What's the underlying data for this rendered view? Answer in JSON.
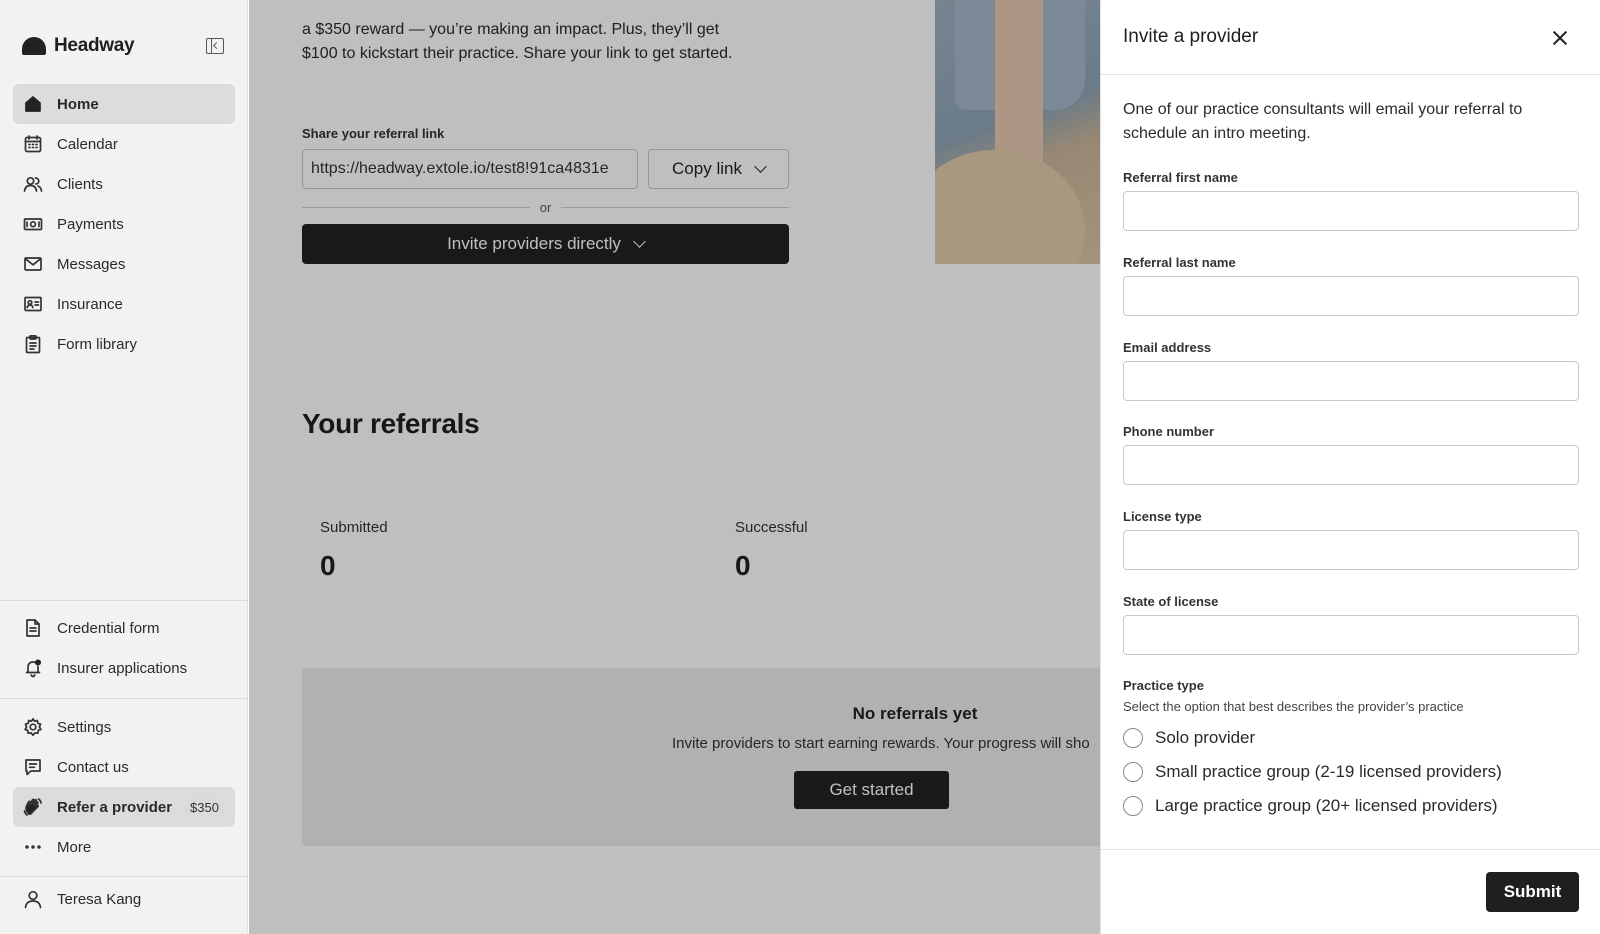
{
  "brand": {
    "name": "Headway",
    "logo_icon": "headway-logo-icon"
  },
  "sidebar": {
    "main_items": [
      {
        "label": "Home",
        "icon": "home-icon",
        "active": true
      },
      {
        "label": "Calendar",
        "icon": "calendar-icon"
      },
      {
        "label": "Clients",
        "icon": "clients-icon"
      },
      {
        "label": "Payments",
        "icon": "payments-icon"
      },
      {
        "label": "Messages",
        "icon": "envelope-icon"
      },
      {
        "label": "Insurance",
        "icon": "id-card-icon"
      },
      {
        "label": "Form library",
        "icon": "clipboard-icon"
      }
    ],
    "mid_items": [
      {
        "label": "Credential form",
        "icon": "document-icon"
      },
      {
        "label": "Insurer applications",
        "icon": "bell-icon"
      }
    ],
    "bottom_items": [
      {
        "label": "Settings",
        "icon": "gear-icon"
      },
      {
        "label": "Contact us",
        "icon": "chat-icon"
      },
      {
        "label": "Refer a provider",
        "icon": "waving-hand-icon",
        "badge": "$350",
        "active": true
      },
      {
        "label": "More",
        "icon": "more-dots-icon"
      }
    ],
    "user": {
      "name": "Teresa Kang",
      "icon": "user-icon"
    }
  },
  "main": {
    "intro_line1": "a $350 reward — you’re making an impact. Plus, they’ll get",
    "intro_line2": "$100 to kickstart their practice. Share your link to get started.",
    "share_label": "Share your referral link",
    "referral_link": "https://headway.extole.io/test8!91ca4831e",
    "copy_link_label": "Copy link",
    "or_text": "or",
    "invite_directly_label": "Invite providers directly",
    "referrals_title": "Your referrals",
    "stats": {
      "submitted_label": "Submitted",
      "submitted_value": "0",
      "successful_label": "Successful",
      "successful_value": "0"
    },
    "empty_state": {
      "title": "No referrals yet",
      "subtitle": "Invite providers to start earning rewards. Your progress will sho",
      "button_label": "Get started"
    }
  },
  "drawer": {
    "title": "Invite a provider",
    "description": "One of our practice consultants will email your referral to schedule an intro meeting.",
    "fields": {
      "first_name_label": "Referral first name",
      "last_name_label": "Referral last name",
      "email_label": "Email address",
      "phone_label": "Phone number",
      "license_type_label": "License type",
      "state_label": "State of license"
    },
    "practice_type": {
      "label": "Practice type",
      "help": "Select the option that best describes the provider’s practice",
      "options": [
        "Solo provider",
        "Small practice group (2-19 licensed providers)",
        "Large practice group (20+ licensed providers)"
      ]
    },
    "submit_label": "Submit"
  }
}
